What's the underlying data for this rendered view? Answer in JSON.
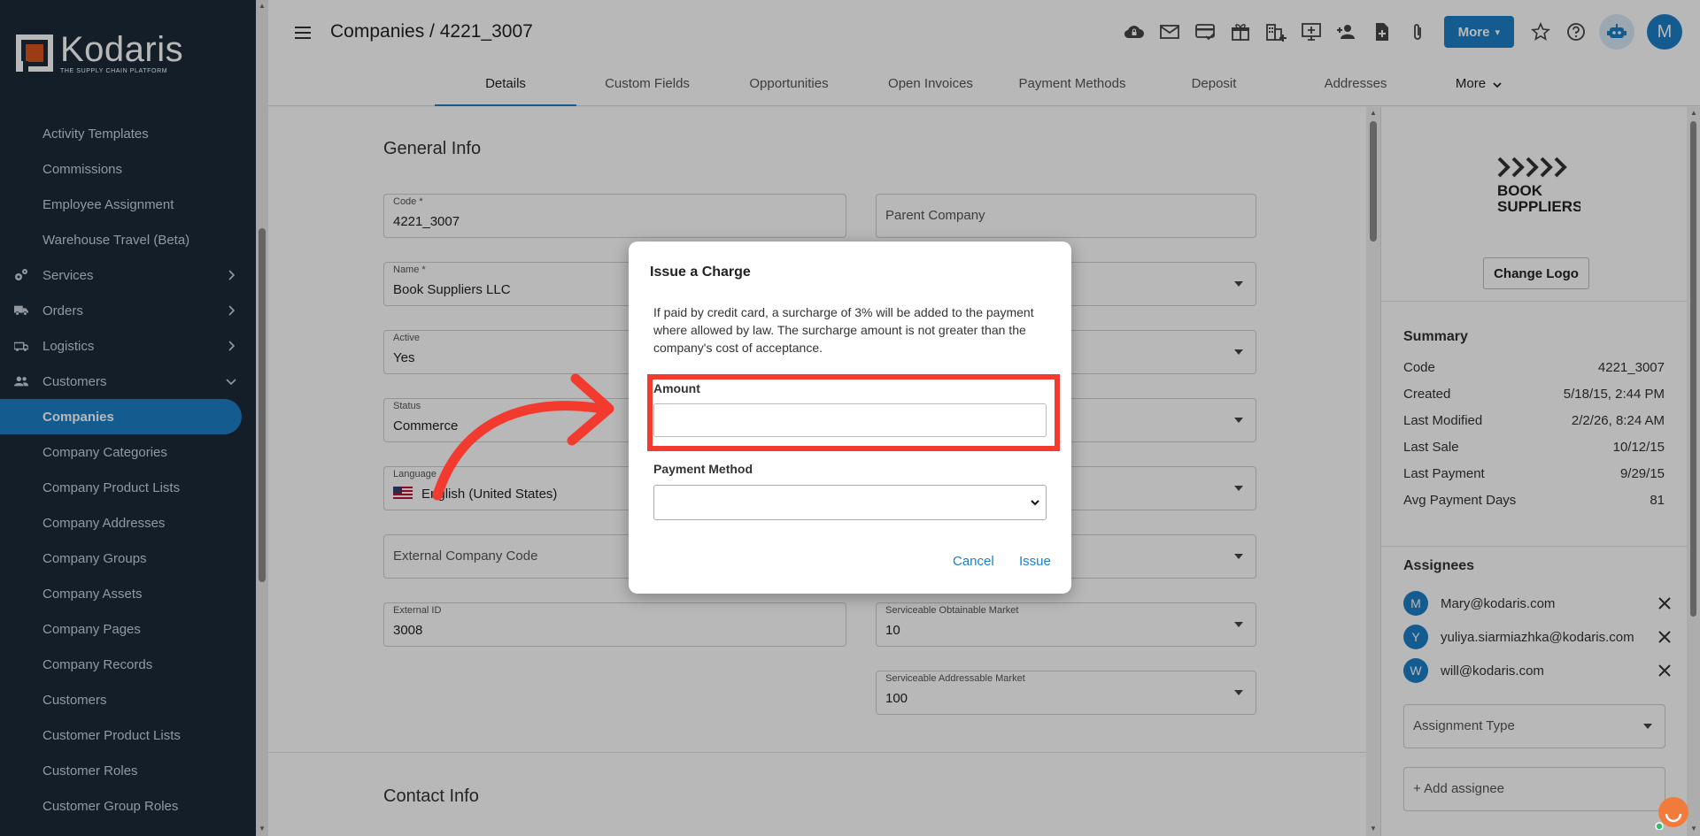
{
  "brand": {
    "name": "Kodaris",
    "tagline": "THE SUPPLY CHAIN PLATFORM"
  },
  "sidebar": {
    "items": [
      {
        "label": "Activity Templates",
        "type": "item"
      },
      {
        "label": "Commissions",
        "type": "item"
      },
      {
        "label": "Employee Assignment",
        "type": "item"
      },
      {
        "label": "Warehouse Travel (Beta)",
        "type": "item"
      },
      {
        "label": "Services",
        "type": "group",
        "icon": "gears-icon",
        "expanded": false
      },
      {
        "label": "Orders",
        "type": "group",
        "icon": "truck-icon",
        "expanded": false
      },
      {
        "label": "Logistics",
        "type": "group",
        "icon": "shipping-icon",
        "expanded": false
      },
      {
        "label": "Customers",
        "type": "group",
        "icon": "users-icon",
        "expanded": true
      },
      {
        "label": "Companies",
        "type": "item",
        "active": true
      },
      {
        "label": "Company Categories",
        "type": "item"
      },
      {
        "label": "Company Product Lists",
        "type": "item"
      },
      {
        "label": "Company Addresses",
        "type": "item"
      },
      {
        "label": "Company Groups",
        "type": "item"
      },
      {
        "label": "Company Assets",
        "type": "item"
      },
      {
        "label": "Company Pages",
        "type": "item"
      },
      {
        "label": "Company Records",
        "type": "item"
      },
      {
        "label": "Customers",
        "type": "item"
      },
      {
        "label": "Customer Product Lists",
        "type": "item"
      },
      {
        "label": "Customer Roles",
        "type": "item"
      },
      {
        "label": "Customer Group Roles",
        "type": "item"
      }
    ]
  },
  "header": {
    "title": "Companies / 4221_3007",
    "more_label": "More",
    "avatar_initial": "M",
    "toolbar_icons": [
      "cloud-lock-icon",
      "mail-icon",
      "card-check-icon",
      "gift-icon",
      "buildings-add-icon",
      "monitor-add-icon",
      "person-add-icon",
      "file-add-icon",
      "paperclip-icon"
    ]
  },
  "tabs": [
    {
      "label": "Details",
      "active": true
    },
    {
      "label": "Custom Fields"
    },
    {
      "label": "Opportunities"
    },
    {
      "label": "Open Invoices"
    },
    {
      "label": "Payment Methods"
    },
    {
      "label": "Deposit"
    },
    {
      "label": "Addresses"
    },
    {
      "label": "More"
    }
  ],
  "general_info": {
    "title": "General Info",
    "code": {
      "label": "Code *",
      "value": "4221_3007"
    },
    "parent_company": {
      "placeholder": "Parent Company"
    },
    "name": {
      "label": "Name *",
      "value": "Book Suppliers LLC"
    },
    "active": {
      "label": "Active",
      "value": "Yes"
    },
    "status": {
      "label": "Status",
      "value": "Commerce"
    },
    "language": {
      "label": "Language",
      "value": "English (United States)"
    },
    "external_company_code": {
      "placeholder": "External Company Code"
    },
    "external_id": {
      "label": "External ID",
      "value": "3008"
    },
    "som": {
      "label": "Serviceable Obtainable Market",
      "value": "10"
    },
    "sam": {
      "label": "Serviceable Addressable Market",
      "value": "100"
    }
  },
  "contact_info": {
    "title": "Contact Info"
  },
  "right_panel": {
    "logo_line1": "BOOK",
    "logo_line2": "SUPPLIERS",
    "change_logo_label": "Change Logo",
    "summary_title": "Summary",
    "summary": [
      {
        "label": "Code",
        "value": "4221_3007"
      },
      {
        "label": "Created",
        "value": "5/18/15, 2:44 PM"
      },
      {
        "label": "Last Modified",
        "value": "2/2/26, 8:24 AM"
      },
      {
        "label": "Last Sale",
        "value": "10/12/15"
      },
      {
        "label": "Last Payment",
        "value": "9/29/15"
      },
      {
        "label": "Avg Payment Days",
        "value": "81"
      }
    ],
    "assignees_title": "Assignees",
    "assignees": [
      {
        "initial": "M",
        "email": "Mary@kodaris.com"
      },
      {
        "initial": "Y",
        "email": "yuliya.siarmiazhka@kodaris.com"
      },
      {
        "initial": "W",
        "email": "will@kodaris.com"
      }
    ],
    "assignment_type_placeholder": "Assignment Type",
    "add_assignee_placeholder": "+ Add assignee"
  },
  "modal": {
    "title": "Issue a Charge",
    "text": "If paid by credit card, a surcharge of 3% will be added to the payment where allowed by law. The surcharge amount is not greater than the company's cost of acceptance.",
    "amount_label": "Amount",
    "amount_value": "",
    "payment_method_label": "Payment Method",
    "payment_method_value": "",
    "cancel_label": "Cancel",
    "issue_label": "Issue"
  },
  "colors": {
    "accent": "#1c7fc8",
    "sidebar_bg": "#1d2a38",
    "highlight": "#f23a2e"
  }
}
